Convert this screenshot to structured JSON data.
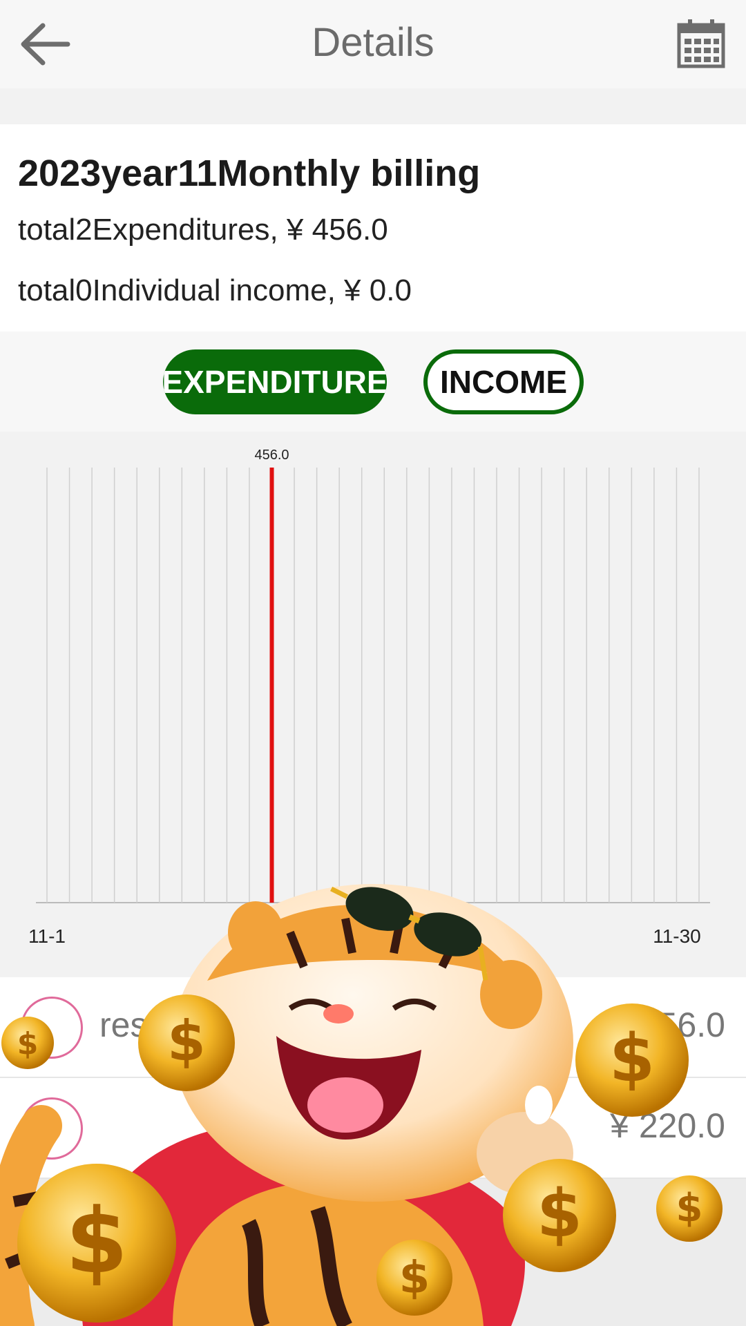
{
  "header": {
    "title": "Details",
    "back_icon": "back-arrow-icon",
    "calendar_icon": "calendar-icon"
  },
  "summary": {
    "month_title": "2023year11Monthly billing",
    "expenditure_line": "total2Expenditures, ¥ 456.0",
    "income_line": "total0Individual income, ¥ 0.0"
  },
  "toggle": {
    "expenditure_label": "EXPENDITURE",
    "income_label": "INCOME",
    "selected": "EXPENDITURE",
    "accent_color": "#0a6b0a"
  },
  "chart_data": {
    "type": "bar",
    "x_start_label": "11-1",
    "x_end_label": "11-30",
    "days": 30,
    "values": [
      0,
      0,
      0,
      0,
      0,
      0,
      0,
      0,
      0,
      0,
      456.0,
      0,
      0,
      0,
      0,
      0,
      0,
      0,
      0,
      0,
      0,
      0,
      0,
      0,
      0,
      0,
      0,
      0,
      0,
      0
    ],
    "peak_label": "456.0",
    "bar_color": "#e01010",
    "grid": true
  },
  "list": {
    "items": [
      {
        "label": "res",
        "amount": "¥ 456.0",
        "icon": "category-icon"
      },
      {
        "label": "",
        "amount": "¥ 220.0",
        "icon": "mail-icon"
      }
    ]
  }
}
